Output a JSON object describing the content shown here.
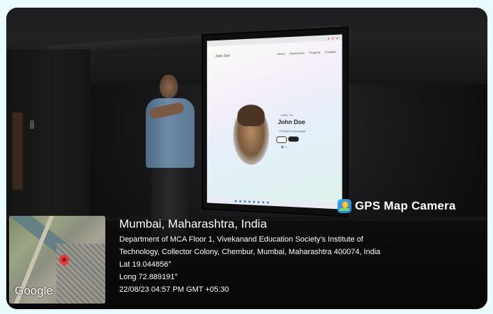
{
  "brand": {
    "label": "GPS Map Camera",
    "icon": "gps-map-camera-icon",
    "icon_color": "#2a8fe0"
  },
  "projection": {
    "logo": "John Doe",
    "nav": [
      "About",
      "Experience",
      "Projects",
      "Contact"
    ],
    "greeting": "Hello, I'm",
    "name": "John Doe",
    "role": "Frontend Developer"
  },
  "location": {
    "title": "Mumbai, Maharashtra, India",
    "address_line1": "Department of MCA Floor 1, Vivekanand Education Society's Institute of",
    "address_line2": "Technology, Collector Colony, Chembur, Mumbai, Maharashtra 400074, India",
    "lat": "Lat 19.044856°",
    "long": "Long 72.889191°",
    "timestamp": "22/08/23 04:57 PM GMT +05:30"
  },
  "map": {
    "logo": "Google",
    "pin_color": "#e53935"
  }
}
